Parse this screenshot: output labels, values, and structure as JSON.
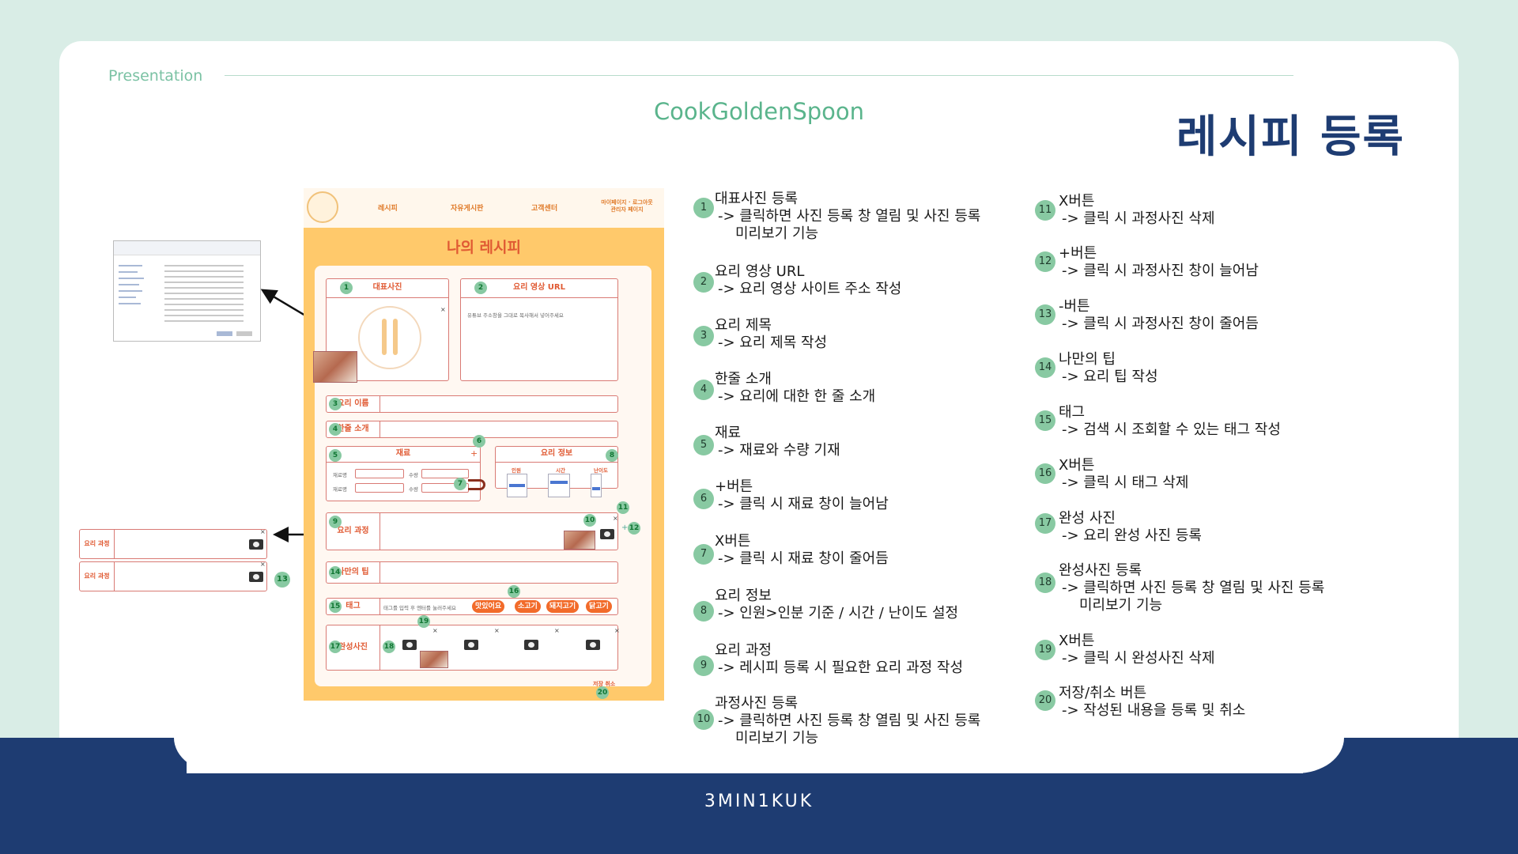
{
  "header": {
    "presentation_label": "Presentation",
    "brand": "CookGoldenSpoon",
    "page_title": "레시피 등록"
  },
  "footer": {
    "team": "3MIN1KUK"
  },
  "mockup": {
    "nav": [
      "레시피",
      "자유게시판",
      "고객센터",
      "마이페이지 · 로그아웃 관리자 페이지"
    ],
    "title": "나의 레시피",
    "main_photo_label": "대표사진",
    "video_url_label": "요리 영상 URL",
    "video_url_placeholder": "유튜브 주소창을 그대로 복사해서 넣어주세요",
    "name_label": "요리 이름",
    "intro_label": "한줄 소개",
    "ingredients_label": "재료",
    "ingredient_name": "재료명",
    "ingredient_qty": "수량",
    "info_label": "요리 정보",
    "info_cols": [
      "인원",
      "시간",
      "난이도"
    ],
    "process_label": "요리 과정",
    "tip_label": "나만의 팁",
    "tag_label": "태그",
    "tag_placeholder": "태그를 입력 후 엔터를 눌러주세요",
    "tags": [
      "맛있어요",
      "소고기",
      "돼지고기",
      "닭고기"
    ],
    "done_photo_label": "완성사진",
    "save_cancel": "저장 취소",
    "plus": "+",
    "x": "×"
  },
  "callouts": [
    {
      "num": "1",
      "title": "대표사진 등록",
      "desc": "-> 클릭하면 사진 등록 창 열림 및 사진 등록",
      "desc2": "미리보기 기능"
    },
    {
      "num": "2",
      "title": "요리 영상 URL",
      "desc": "-> 요리 영상 사이트 주소 작성"
    },
    {
      "num": "3",
      "title": "요리 제목",
      "desc": "-> 요리 제목 작성"
    },
    {
      "num": "4",
      "title": "한줄 소개",
      "desc": "-> 요리에 대한 한 줄 소개"
    },
    {
      "num": "5",
      "title": "재료",
      "desc": "-> 재료와 수량 기재"
    },
    {
      "num": "6",
      "title": "+버튼",
      "desc": "-> 클릭 시 재료 창이 늘어남"
    },
    {
      "num": "7",
      "title": "X버튼",
      "desc": "-> 클릭 시 재료 창이 줄어듬"
    },
    {
      "num": "8",
      "title": "요리 정보",
      "desc": "-> 인원>인분 기준 / 시간 / 난이도 설정"
    },
    {
      "num": "9",
      "title": "요리 과정",
      "desc": "-> 레시피 등록 시 필요한 요리 과정 작성"
    },
    {
      "num": "10",
      "title": "과정사진 등록",
      "desc": "-> 클릭하면 사진 등록 창 열림 및 사진 등록",
      "desc2": "미리보기 기능"
    },
    {
      "num": "11",
      "title": "X버튼",
      "desc": "-> 클릭 시 과정사진 삭제"
    },
    {
      "num": "12",
      "title": "+버튼",
      "desc": "-> 클릭 시 과정사진 창이 늘어남"
    },
    {
      "num": "13",
      "title": "-버튼",
      "desc": "-> 클릭 시 과정사진 창이 줄어듬"
    },
    {
      "num": "14",
      "title": "나만의 팁",
      "desc": "-> 요리 팁 작성"
    },
    {
      "num": "15",
      "title": "태그",
      "desc": "-> 검색 시 조회할 수 있는 태그 작성"
    },
    {
      "num": "16",
      "title": "X버튼",
      "desc": "-> 클릭 시 태그 삭제"
    },
    {
      "num": "17",
      "title": "완성 사진",
      "desc": "-> 요리 완성 사진 등록"
    },
    {
      "num": "18",
      "title": "완성사진 등록",
      "desc": "-> 클릭하면 사진 등록 창 열림 및 사진 등록",
      "desc2": "미리보기 기능"
    },
    {
      "num": "19",
      "title": "X버튼",
      "desc": "-> 클릭 시 완성사진 삭제"
    },
    {
      "num": "20",
      "title": "저장/취소 버튼",
      "desc": "-> 작성된 내용을 등록 및 취소"
    }
  ]
}
